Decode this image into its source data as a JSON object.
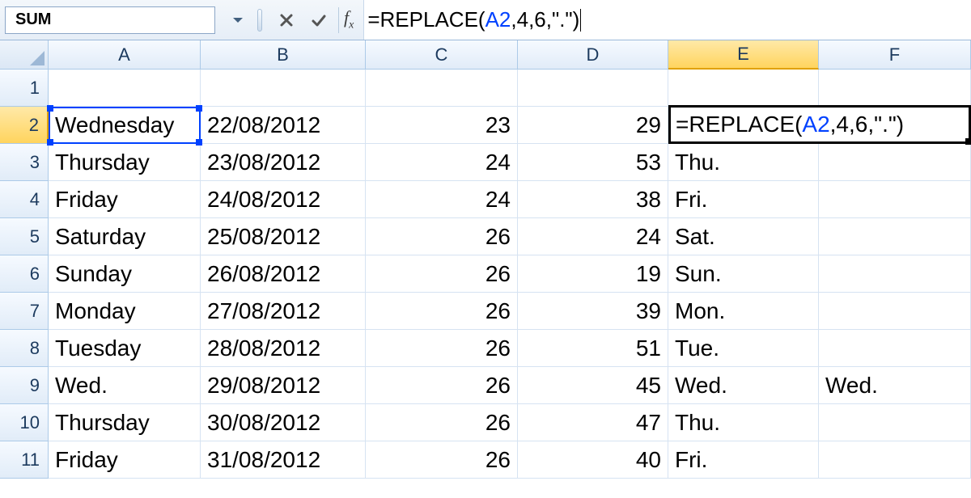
{
  "formula_bar": {
    "name_box": "SUM",
    "formula_prefix": "=REPLACE(",
    "formula_ref": "A2",
    "formula_suffix": ",4,6,\".\")"
  },
  "columns": [
    "A",
    "B",
    "C",
    "D",
    "E",
    "F"
  ],
  "row_numbers": [
    1,
    2,
    3,
    4,
    5,
    6,
    7,
    8,
    9,
    10,
    11
  ],
  "active": {
    "col": "E",
    "row": 2
  },
  "editing_cell": {
    "prefix": "=REPLACE(",
    "ref": "A2",
    "suffix": ",4,6,\".\")"
  },
  "rows": [
    {
      "A": "",
      "B": "",
      "C": "",
      "D": "",
      "E": "",
      "F": ""
    },
    {
      "A": "Wednesday",
      "B": "22/08/2012",
      "C": "23",
      "D": "29",
      "E": "",
      "F": ""
    },
    {
      "A": "Thursday",
      "B": "23/08/2012",
      "C": "24",
      "D": "53",
      "E": "Thu.",
      "F": ""
    },
    {
      "A": "Friday",
      "B": "24/08/2012",
      "C": "24",
      "D": "38",
      "E": "Fri.",
      "F": ""
    },
    {
      "A": "Saturday",
      "B": "25/08/2012",
      "C": "26",
      "D": "24",
      "E": "Sat.",
      "F": ""
    },
    {
      "A": "Sunday",
      "B": "26/08/2012",
      "C": "26",
      "D": "19",
      "E": "Sun.",
      "F": ""
    },
    {
      "A": "Monday",
      "B": "27/08/2012",
      "C": "26",
      "D": "39",
      "E": "Mon.",
      "F": ""
    },
    {
      "A": "Tuesday",
      "B": "28/08/2012",
      "C": "26",
      "D": "51",
      "E": "Tue.",
      "F": ""
    },
    {
      "A": "Wed.",
      "B": "29/08/2012",
      "C": "26",
      "D": "45",
      "E": "Wed.",
      "F": "Wed."
    },
    {
      "A": "Thursday",
      "B": "30/08/2012",
      "C": "26",
      "D": "47",
      "E": "Thu.",
      "F": ""
    },
    {
      "A": "Friday",
      "B": "31/08/2012",
      "C": "26",
      "D": "40",
      "E": "Fri.",
      "F": ""
    }
  ]
}
